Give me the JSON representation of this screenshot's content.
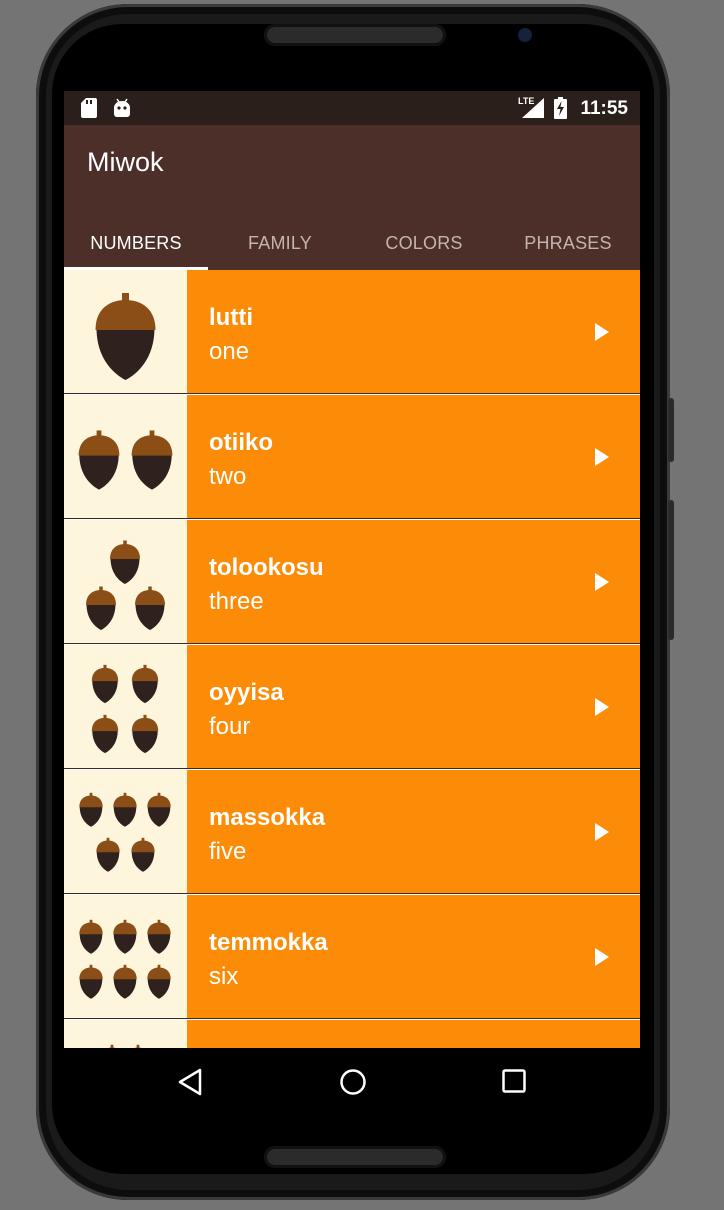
{
  "status_bar": {
    "time": "11:55",
    "network_label": "LTE"
  },
  "app": {
    "title": "Miwok"
  },
  "tabs": [
    {
      "label": "NUMBERS",
      "selected": true
    },
    {
      "label": "FAMILY",
      "selected": false
    },
    {
      "label": "COLORS",
      "selected": false
    },
    {
      "label": "PHRASES",
      "selected": false
    }
  ],
  "words": [
    {
      "miwok": "lutti",
      "default": "one",
      "acorn_count": 1
    },
    {
      "miwok": "otiiko",
      "default": "two",
      "acorn_count": 2
    },
    {
      "miwok": "tolookosu",
      "default": "three",
      "acorn_count": 3
    },
    {
      "miwok": "oyyisa",
      "default": "four",
      "acorn_count": 4
    },
    {
      "miwok": "massokka",
      "default": "five",
      "acorn_count": 5
    },
    {
      "miwok": "temmokka",
      "default": "six",
      "acorn_count": 6
    },
    {
      "miwok": "",
      "default": "",
      "acorn_count": 2
    }
  ],
  "colors": {
    "status_bar": "#2b1f1c",
    "app_bar": "#4d2f29",
    "list_item": "#fc8c08",
    "image_bg": "#fef6dc",
    "acorn_cap": "#8b4e16",
    "acorn_body": "#2f211e"
  },
  "icons": {
    "play": "play-arrow-icon",
    "back": "nav-back-icon",
    "home": "nav-home-icon",
    "recents": "nav-recents-icon"
  }
}
